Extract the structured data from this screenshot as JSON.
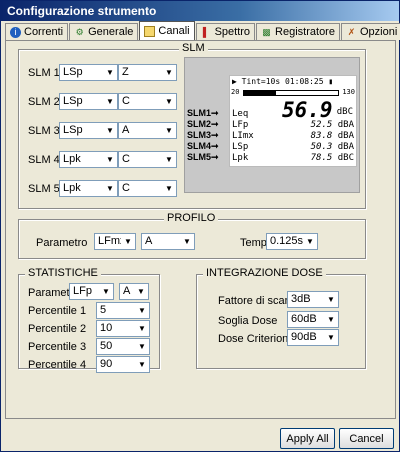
{
  "window": {
    "title": "Configurazione strumento"
  },
  "tabs": [
    {
      "label": "Correnti",
      "icon": "info-icon"
    },
    {
      "label": "Generale",
      "icon": "generale-icon"
    },
    {
      "label": "Canali",
      "icon": "canali-icon",
      "active": true
    },
    {
      "label": "Spettro",
      "icon": "spettro-icon"
    },
    {
      "label": "Registratore",
      "icon": "registratore-icon"
    },
    {
      "label": "Opzioni",
      "icon": "opzioni-icon"
    }
  ],
  "slm": {
    "title": "SLM",
    "rows": [
      {
        "label": "SLM 1",
        "param": "LSp",
        "weight": "Z"
      },
      {
        "label": "SLM 2",
        "param": "LSp",
        "weight": "C"
      },
      {
        "label": "SLM 3",
        "param": "LSp",
        "weight": "A"
      },
      {
        "label": "SLM 4",
        "param": "Lpk",
        "weight": "C"
      },
      {
        "label": "SLM 5",
        "param": "Lpk",
        "weight": "C"
      }
    ]
  },
  "lcd": {
    "status": "Tint=10s 01:08:25",
    "scale_min": "20",
    "scale_max": "130",
    "main_value": "56.9",
    "main_unit": "dBC",
    "rows": [
      {
        "tag": "SLM1",
        "param": "Leq",
        "value": "",
        "unit": ""
      },
      {
        "tag": "SLM2",
        "param": "LFp",
        "value": "52.5",
        "unit": "dBA"
      },
      {
        "tag": "SLM3",
        "param": "LImx",
        "value": "83.8",
        "unit": "dBA"
      },
      {
        "tag": "SLM4",
        "param": "LSp",
        "value": "50.3",
        "unit": "dBA"
      },
      {
        "tag": "SLM5",
        "param": "Lpk",
        "value": "78.5",
        "unit": "dBC"
      }
    ]
  },
  "profilo": {
    "title": "PROFILO",
    "param_label": "Parametro",
    "param_value": "LFmx",
    "weight_value": "A",
    "tempo_label": "Tempo",
    "tempo_value": "0.125s"
  },
  "statistiche": {
    "title": "STATISTICHE",
    "param_label": "Parametro",
    "param_value": "LFp",
    "weight_value": "A",
    "percentiles": [
      {
        "label": "Percentile 1",
        "value": "5"
      },
      {
        "label": "Percentile 2",
        "value": "10"
      },
      {
        "label": "Percentile 3",
        "value": "50"
      },
      {
        "label": "Percentile 4",
        "value": "90"
      }
    ]
  },
  "dose": {
    "title": "INTEGRAZIONE DOSE",
    "fields": [
      {
        "label": "Fattore di scambio",
        "value": "3dB"
      },
      {
        "label": "Soglia Dose",
        "value": "60dB"
      },
      {
        "label": "Dose Criterion",
        "value": "90dB"
      }
    ]
  },
  "buttons": {
    "apply_all": "Apply All",
    "cancel": "Cancel"
  }
}
